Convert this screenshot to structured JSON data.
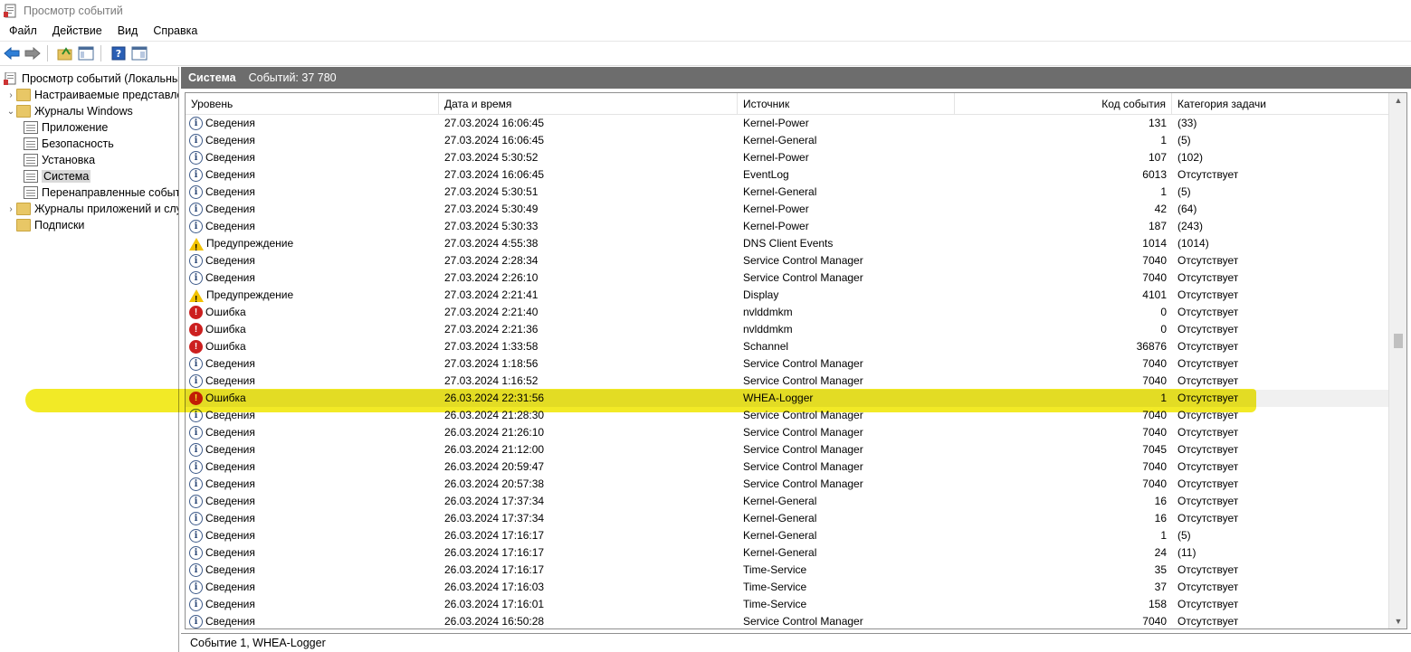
{
  "window": {
    "title": "Просмотр событий"
  },
  "menu": [
    "Файл",
    "Действие",
    "Вид",
    "Справка"
  ],
  "toolbar": [
    "back-arrow-icon",
    "forward-arrow-icon",
    "open-folder-icon",
    "console-tree-icon",
    "help-icon",
    "action-pane-icon"
  ],
  "tree": {
    "root": "Просмотр событий (Локальный)",
    "items": [
      {
        "label": "Настраиваемые представления",
        "indent": 1,
        "expand": "collapsed",
        "icon": "folder"
      },
      {
        "label": "Журналы Windows",
        "indent": 1,
        "expand": "expanded",
        "icon": "folder"
      },
      {
        "label": "Приложение",
        "indent": 2,
        "expand": "",
        "icon": "log"
      },
      {
        "label": "Безопасность",
        "indent": 2,
        "expand": "",
        "icon": "log"
      },
      {
        "label": "Установка",
        "indent": 2,
        "expand": "",
        "icon": "log"
      },
      {
        "label": "Система",
        "indent": 2,
        "expand": "",
        "icon": "log",
        "selected": true
      },
      {
        "label": "Перенаправленные события",
        "indent": 2,
        "expand": "",
        "icon": "log"
      },
      {
        "label": "Журналы приложений и служб",
        "indent": 1,
        "expand": "collapsed",
        "icon": "folder"
      },
      {
        "label": "Подписки",
        "indent": 1,
        "expand": "",
        "icon": "folder"
      }
    ]
  },
  "panel": {
    "title": "Система",
    "count": "Событий: 37 780"
  },
  "columns": {
    "level": "Уровень",
    "date": "Дата и время",
    "source": "Источник",
    "code": "Код события",
    "category": "Категория задачи"
  },
  "events": [
    {
      "type": "info",
      "level": "Сведения",
      "date": "27.03.2024 16:06:45",
      "source": "Kernel-Power",
      "code": "131",
      "category": "(33)"
    },
    {
      "type": "info",
      "level": "Сведения",
      "date": "27.03.2024 16:06:45",
      "source": "Kernel-General",
      "code": "1",
      "category": "(5)"
    },
    {
      "type": "info",
      "level": "Сведения",
      "date": "27.03.2024 5:30:52",
      "source": "Kernel-Power",
      "code": "107",
      "category": "(102)"
    },
    {
      "type": "info",
      "level": "Сведения",
      "date": "27.03.2024 16:06:45",
      "source": "EventLog",
      "code": "6013",
      "category": "Отсутствует"
    },
    {
      "type": "info",
      "level": "Сведения",
      "date": "27.03.2024 5:30:51",
      "source": "Kernel-General",
      "code": "1",
      "category": "(5)"
    },
    {
      "type": "info",
      "level": "Сведения",
      "date": "27.03.2024 5:30:49",
      "source": "Kernel-Power",
      "code": "42",
      "category": "(64)"
    },
    {
      "type": "info",
      "level": "Сведения",
      "date": "27.03.2024 5:30:33",
      "source": "Kernel-Power",
      "code": "187",
      "category": "(243)"
    },
    {
      "type": "warn",
      "level": "Предупреждение",
      "date": "27.03.2024 4:55:38",
      "source": "DNS Client Events",
      "code": "1014",
      "category": "(1014)"
    },
    {
      "type": "info",
      "level": "Сведения",
      "date": "27.03.2024 2:28:34",
      "source": "Service Control Manager",
      "code": "7040",
      "category": "Отсутствует"
    },
    {
      "type": "info",
      "level": "Сведения",
      "date": "27.03.2024 2:26:10",
      "source": "Service Control Manager",
      "code": "7040",
      "category": "Отсутствует"
    },
    {
      "type": "warn",
      "level": "Предупреждение",
      "date": "27.03.2024 2:21:41",
      "source": "Display",
      "code": "4101",
      "category": "Отсутствует"
    },
    {
      "type": "error",
      "level": "Ошибка",
      "date": "27.03.2024 2:21:40",
      "source": "nvlddmkm",
      "code": "0",
      "category": "Отсутствует"
    },
    {
      "type": "error",
      "level": "Ошибка",
      "date": "27.03.2024 2:21:36",
      "source": "nvlddmkm",
      "code": "0",
      "category": "Отсутствует"
    },
    {
      "type": "error",
      "level": "Ошибка",
      "date": "27.03.2024 1:33:58",
      "source": "Schannel",
      "code": "36876",
      "category": "Отсутствует"
    },
    {
      "type": "info",
      "level": "Сведения",
      "date": "27.03.2024 1:18:56",
      "source": "Service Control Manager",
      "code": "7040",
      "category": "Отсутствует"
    },
    {
      "type": "info",
      "level": "Сведения",
      "date": "27.03.2024 1:16:52",
      "source": "Service Control Manager",
      "code": "7040",
      "category": "Отсутствует"
    },
    {
      "type": "error",
      "level": "Ошибка",
      "date": "26.03.2024 22:31:56",
      "source": "WHEA-Logger",
      "code": "1",
      "category": "Отсутствует",
      "selected": true
    },
    {
      "type": "info",
      "level": "Сведения",
      "date": "26.03.2024 21:28:30",
      "source": "Service Control Manager",
      "code": "7040",
      "category": "Отсутствует"
    },
    {
      "type": "info",
      "level": "Сведения",
      "date": "26.03.2024 21:26:10",
      "source": "Service Control Manager",
      "code": "7040",
      "category": "Отсутствует"
    },
    {
      "type": "info",
      "level": "Сведения",
      "date": "26.03.2024 21:12:00",
      "source": "Service Control Manager",
      "code": "7045",
      "category": "Отсутствует"
    },
    {
      "type": "info",
      "level": "Сведения",
      "date": "26.03.2024 20:59:47",
      "source": "Service Control Manager",
      "code": "7040",
      "category": "Отсутствует"
    },
    {
      "type": "info",
      "level": "Сведения",
      "date": "26.03.2024 20:57:38",
      "source": "Service Control Manager",
      "code": "7040",
      "category": "Отсутствует"
    },
    {
      "type": "info",
      "level": "Сведения",
      "date": "26.03.2024 17:37:34",
      "source": "Kernel-General",
      "code": "16",
      "category": "Отсутствует"
    },
    {
      "type": "info",
      "level": "Сведения",
      "date": "26.03.2024 17:37:34",
      "source": "Kernel-General",
      "code": "16",
      "category": "Отсутствует"
    },
    {
      "type": "info",
      "level": "Сведения",
      "date": "26.03.2024 17:16:17",
      "source": "Kernel-General",
      "code": "1",
      "category": "(5)"
    },
    {
      "type": "info",
      "level": "Сведения",
      "date": "26.03.2024 17:16:17",
      "source": "Kernel-General",
      "code": "24",
      "category": "(11)"
    },
    {
      "type": "info",
      "level": "Сведения",
      "date": "26.03.2024 17:16:17",
      "source": "Time-Service",
      "code": "35",
      "category": "Отсутствует"
    },
    {
      "type": "info",
      "level": "Сведения",
      "date": "26.03.2024 17:16:03",
      "source": "Time-Service",
      "code": "37",
      "category": "Отсутствует"
    },
    {
      "type": "info",
      "level": "Сведения",
      "date": "26.03.2024 17:16:01",
      "source": "Time-Service",
      "code": "158",
      "category": "Отсутствует"
    },
    {
      "type": "info",
      "level": "Сведения",
      "date": "26.03.2024 16:50:28",
      "source": "Service Control Manager",
      "code": "7040",
      "category": "Отсутствует"
    }
  ],
  "status": "Событие 1, WHEA-Logger",
  "colors": {
    "highlighter": "#f0e600",
    "header_bg": "#6d6d6d",
    "error": "#cc1f1f",
    "warning": "#f2c200",
    "info": "#3e5b8a"
  }
}
